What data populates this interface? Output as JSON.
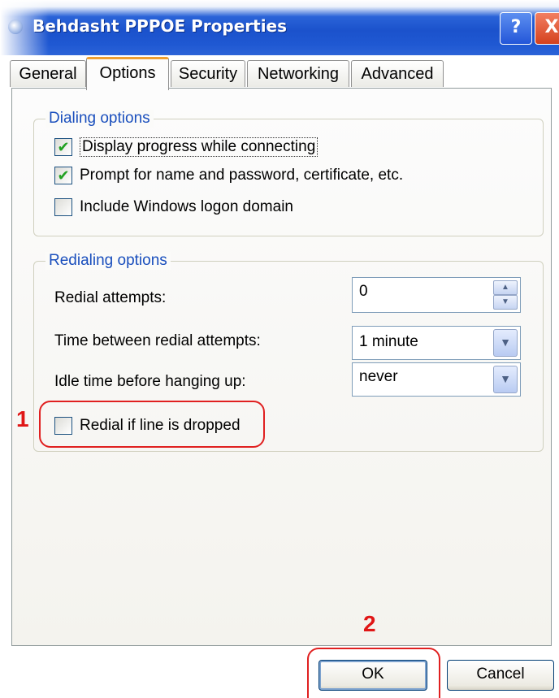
{
  "window": {
    "title": "Behdasht PPPOE Properties",
    "help_glyph": "?",
    "close_glyph": "X"
  },
  "tabs": [
    {
      "label": "General"
    },
    {
      "label": "Options"
    },
    {
      "label": "Security"
    },
    {
      "label": "Networking"
    },
    {
      "label": "Advanced"
    }
  ],
  "dialing": {
    "title": "Dialing options",
    "items": [
      {
        "label": "Display progress while connecting",
        "checked": true
      },
      {
        "label": "Prompt for name and password, certificate, etc.",
        "checked": true
      },
      {
        "label": "Include Windows logon domain",
        "checked": false
      }
    ]
  },
  "redialing": {
    "title": "Redialing options",
    "attempts_label": "Redial attempts:",
    "attempts_value": "0",
    "between_label": "Time between redial attempts:",
    "between_value": "1 minute",
    "idle_label": "Idle time before hanging up:",
    "idle_value": "never",
    "redial_drop_label": "Redial if line is dropped",
    "redial_drop_checked": false
  },
  "annotations": {
    "step1": "1",
    "step2": "2"
  },
  "buttons": {
    "ok": "OK",
    "cancel": "Cancel"
  },
  "colors": {
    "title_bar": "#1f58d2",
    "group_title": "#1a4fbd",
    "callout": "#e02020",
    "check": "#21a121"
  }
}
